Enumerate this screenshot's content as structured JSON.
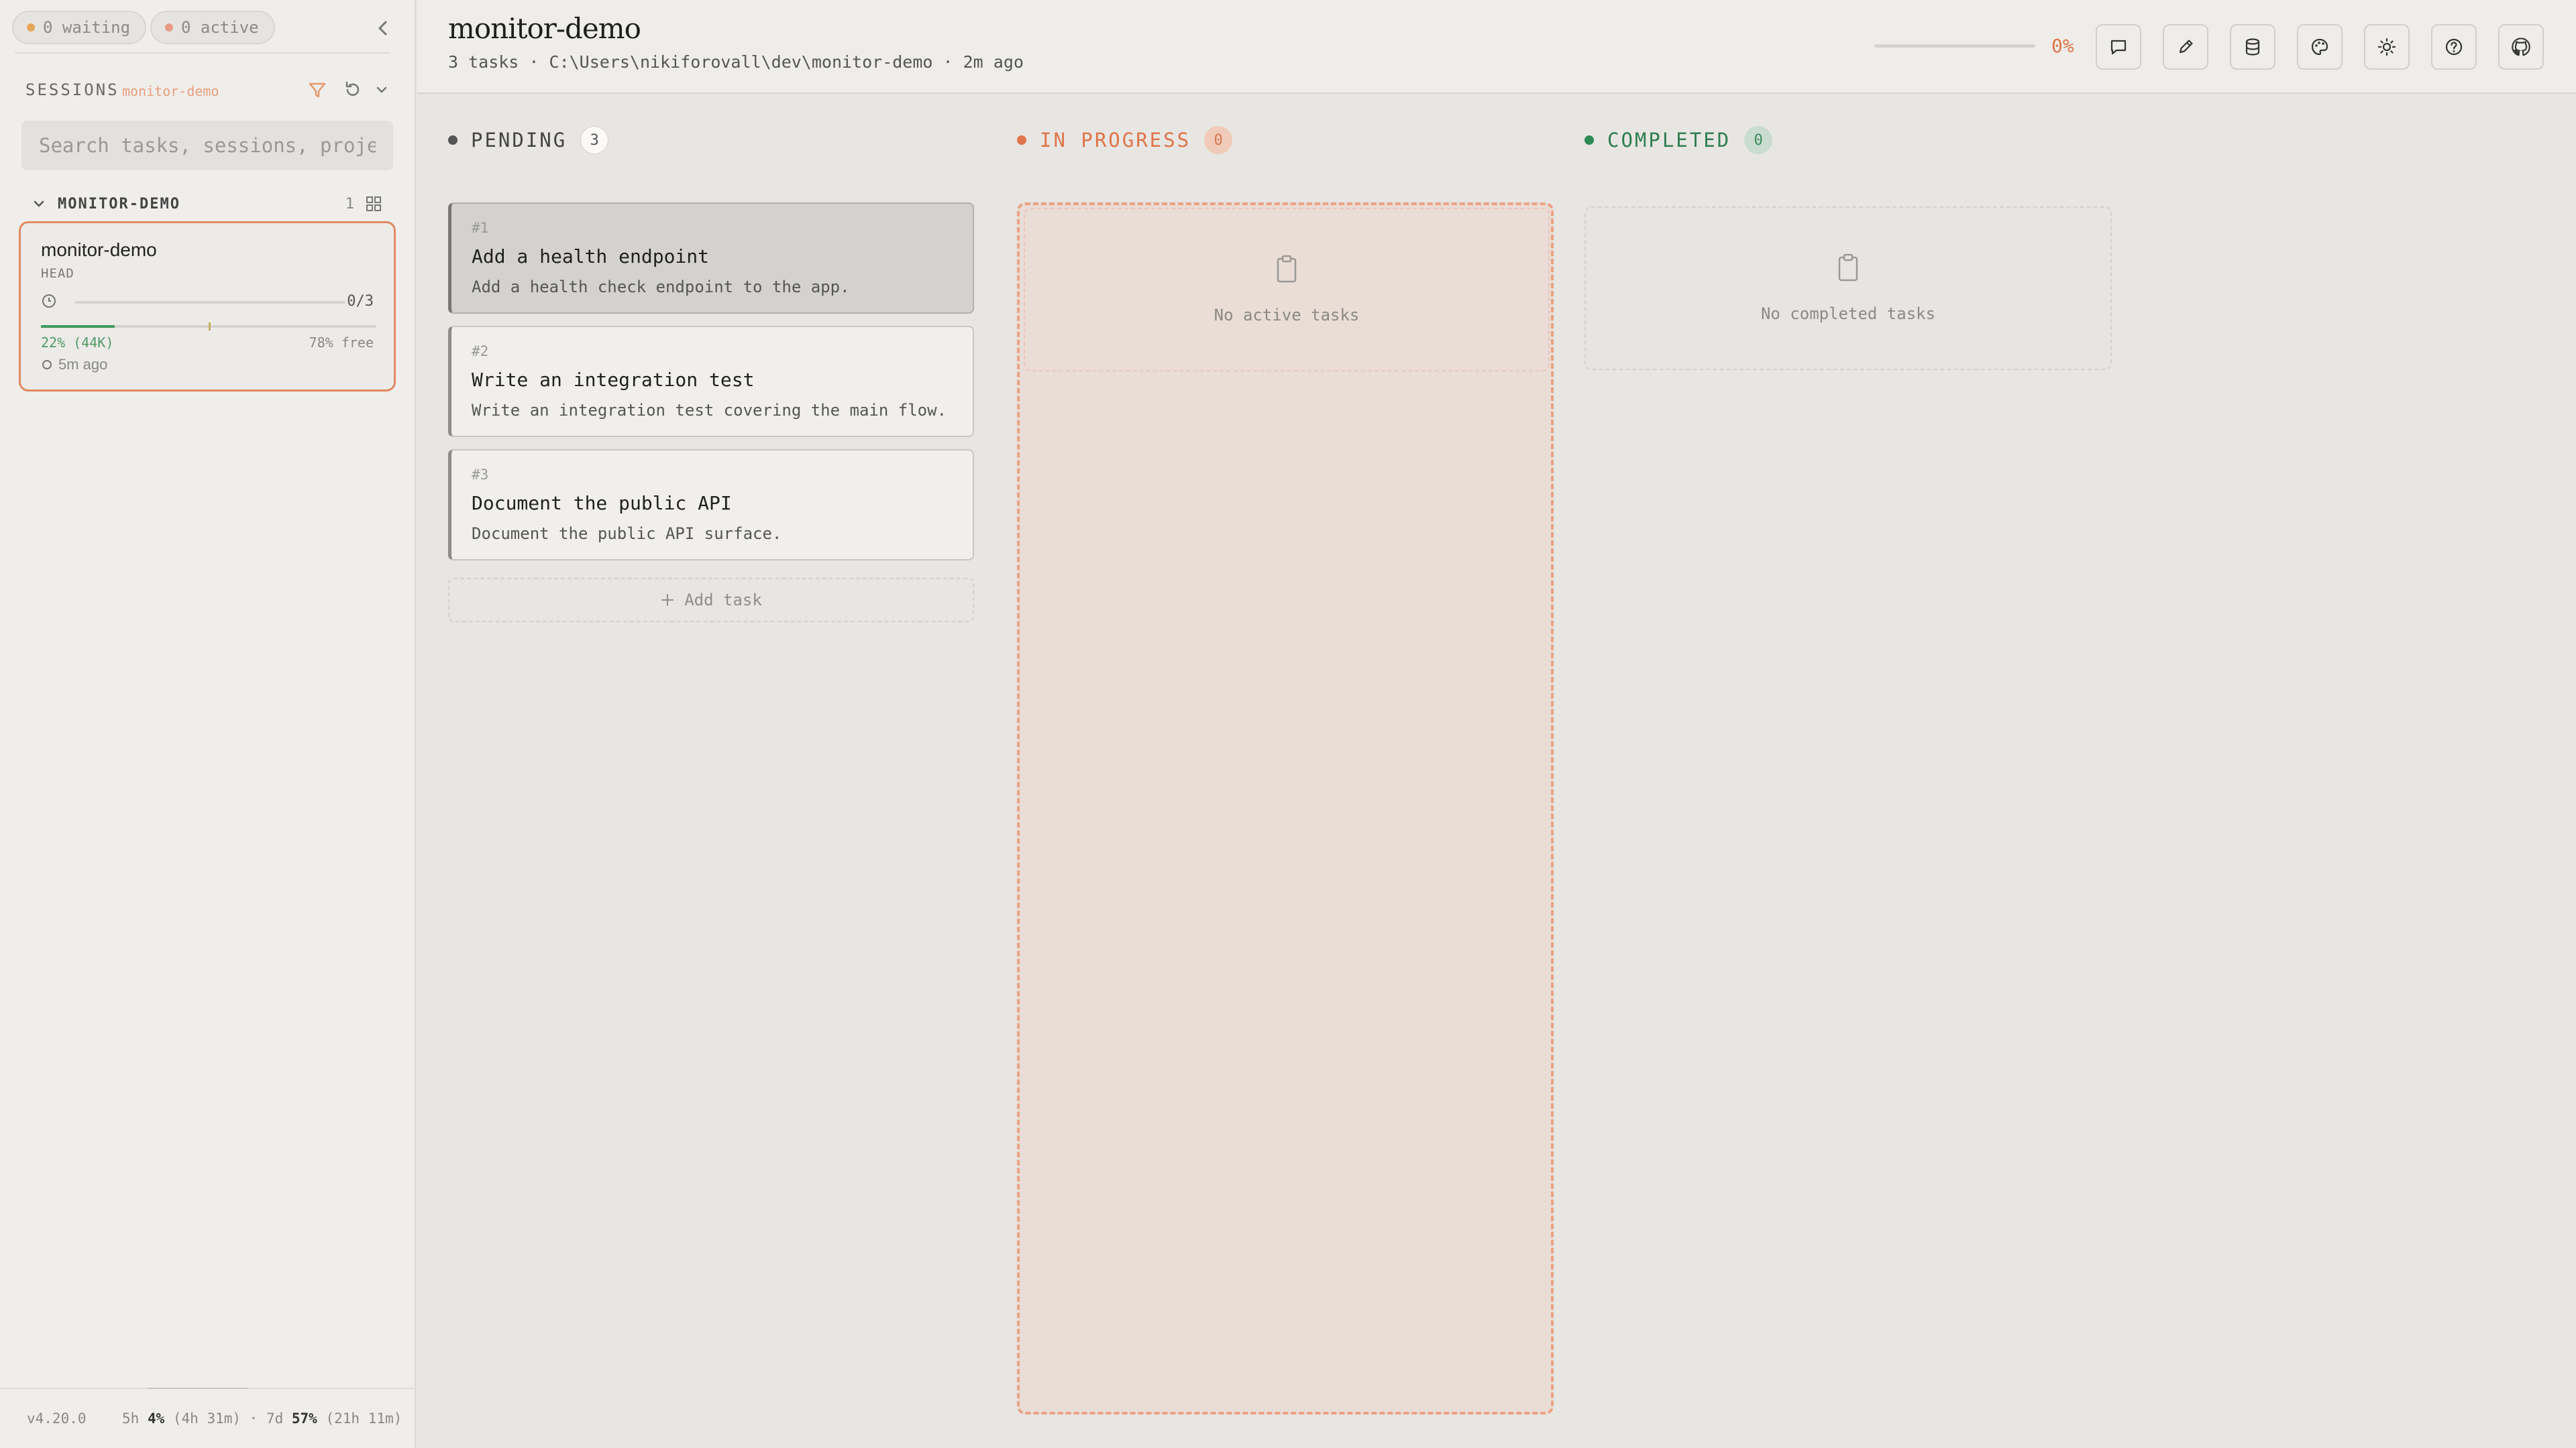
{
  "sidebar": {
    "waiting_label": "0 waiting",
    "active_label": "0 active",
    "sessions_title": "SESSIONS",
    "sessions_project": "monitor-demo",
    "search_placeholder": "Search tasks, sessions, projects",
    "group": {
      "name": "MONITOR-DEMO",
      "count": "1"
    },
    "session": {
      "title": "monitor-demo",
      "branch": "HEAD",
      "progress_label": "0/3",
      "progress_fraction": 0,
      "context_used_fraction": 0.22,
      "context_used_label": "22% (44K)",
      "context_free_label": "78% free",
      "updated": "5m ago"
    },
    "footer": {
      "version": "v4.20.0",
      "usage_5h_prefix": "5h ",
      "usage_5h_pct": "4%",
      "usage_5h_rest": " (4h 31m) · 7d ",
      "usage_7d_pct": "57%",
      "usage_7d_rest": " (21h 11m)"
    }
  },
  "header": {
    "title": "monitor-demo",
    "subtitle": "3 tasks · C:\\Users\\nikiforovall\\dev\\monitor-demo · 2m ago",
    "progress_label": "0%",
    "progress_fraction": 0,
    "buttons": [
      "chat-icon",
      "pencil-icon",
      "database-icon",
      "palette-icon",
      "sun-icon",
      "help-icon",
      "github-icon"
    ]
  },
  "columns": {
    "pending": {
      "label": "PENDING",
      "count": "3",
      "color": "#555555"
    },
    "in_progress": {
      "label": "IN PROGRESS",
      "count": "0",
      "color": "#e0744a",
      "empty": "No active tasks"
    },
    "completed": {
      "label": "COMPLETED",
      "count": "0",
      "color": "#2e8b57",
      "empty": "No completed tasks"
    }
  },
  "tasks": [
    {
      "id": "#1",
      "title": "Add a health endpoint",
      "desc": "Add a health check endpoint to the app."
    },
    {
      "id": "#2",
      "title": "Write an integration test",
      "desc": "Write an integration test covering the main flow."
    },
    {
      "id": "#3",
      "title": "Document the public API",
      "desc": "Document the public API surface."
    }
  ],
  "add_task_label": "Add task"
}
